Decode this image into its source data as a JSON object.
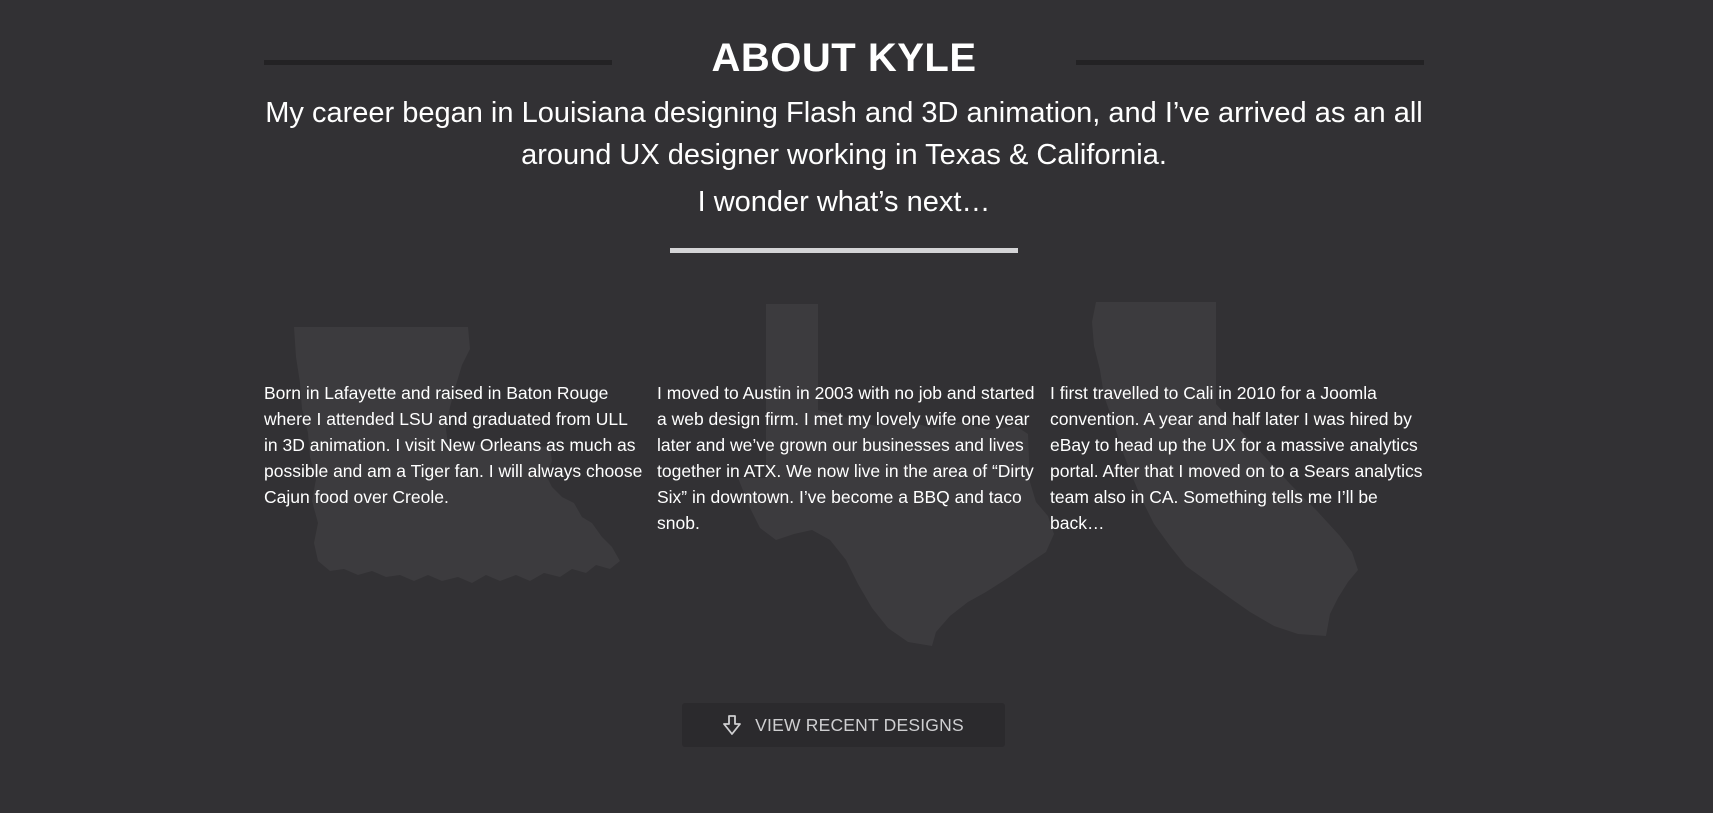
{
  "header": {
    "title": "ABOUT KYLE",
    "intro": "My career began in Louisiana designing Flash and 3D animation, and I’ve arrived as an all around UX designer working in Texas & California.",
    "next": "I wonder what’s next…"
  },
  "columns": [
    {
      "state": "louisiana-map",
      "text": "Born in Lafayette and raised in Baton Rouge where I attended LSU and graduated from ULL in 3D animation. I visit New Orleans as much as possible and am a Tiger fan. I will always choose Cajun food over Creole."
    },
    {
      "state": "texas-map",
      "text": "I moved to Austin in 2003 with no job and started a web design firm. I met my lovely wife one year later and we’ve grown our businesses and lives together in ATX. We now live in the area of “Dirty Six” in downtown. I’ve become a BBQ and taco snob."
    },
    {
      "state": "california-map",
      "text": "I first travelled to Cali in 2010 for a Joomla convention. A year and half later I was hired by eBay to head up the UX for a massive analytics portal. After that I moved on to a Sears analytics team also in CA. Something tells me I’ll be back…"
    }
  ],
  "cta": {
    "icon": "arrow-down-icon",
    "label": "VIEW RECENT DESIGNS"
  },
  "colors": {
    "background": "#323134",
    "map_fill": "#3c3b3e",
    "accent_line": "#d4d4d6"
  }
}
